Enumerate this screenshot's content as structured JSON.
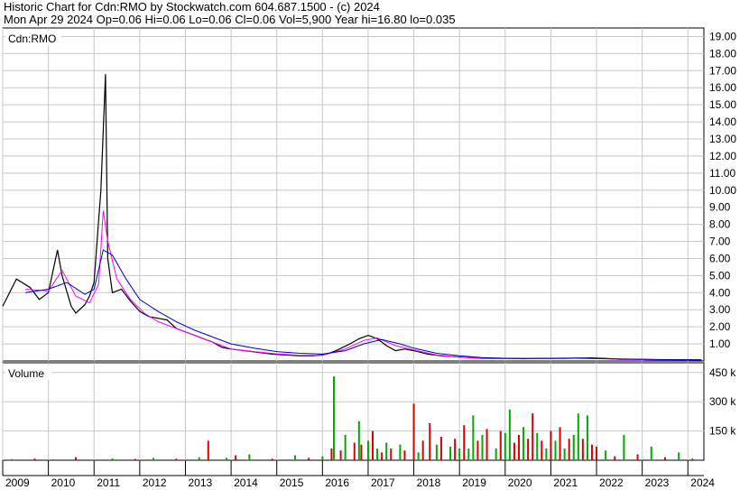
{
  "header": {
    "line1": "Historic Chart for Cdn:RMO by Stockwatch.com 604.687.1500 - (c) 2024",
    "line2": "Mon Apr 29 2024  Op=0.06  Hi=0.06  Lo=0.06  Cl=0.06  Vol=5,900  Year hi=16.80  lo=0.035"
  },
  "colors": {
    "price": "#000000",
    "ma_short": "#ff00ff",
    "ma_long": "#0000cc",
    "vol_up": "#00aa00",
    "vol_down": "#dd0000",
    "grid": "#c8c8c8"
  },
  "chart_data": [
    {
      "type": "line",
      "title": "Cdn:RMO",
      "ylim": [
        0,
        19.5
      ],
      "y_ticks": [
        "1.00",
        "2.00",
        "3.00",
        "4.00",
        "5.00",
        "6.00",
        "7.00",
        "8.00",
        "9.00",
        "10.00",
        "11.00",
        "12.00",
        "13.00",
        "14.00",
        "15.00",
        "16.00",
        "17.00",
        "18.00",
        "19.00"
      ],
      "x_ticks": [
        "2009",
        "2010",
        "2011",
        "2012",
        "2013",
        "2014",
        "2015",
        "2016",
        "2017",
        "2018",
        "2019",
        "2020",
        "2021",
        "2022",
        "2023",
        "2024"
      ],
      "series": [
        {
          "name": "",
          "x": [
            2009.0,
            2009.3,
            2009.6,
            2009.8,
            2010.0,
            2010.2,
            2010.3,
            2010.5,
            2010.6,
            2010.8,
            2010.9,
            2011.0,
            2011.15,
            2011.25,
            2011.3,
            2011.4,
            2011.6,
            2011.8,
            2012.0,
            2012.2,
            2012.4,
            2012.6,
            2012.8,
            2013.0,
            2013.2,
            2013.4,
            2013.6,
            2013.8,
            2014.0,
            2014.3,
            2014.6,
            2014.9,
            2015.2,
            2015.5,
            2015.8,
            2016.1,
            2016.3,
            2016.6,
            2016.8,
            2017.0,
            2017.2,
            2017.4,
            2017.6,
            2017.8,
            2018.0,
            2018.3,
            2018.6,
            2018.9,
            2019.2,
            2019.5,
            2019.8,
            2020.1,
            2020.4,
            2020.7,
            2021.0,
            2021.3,
            2021.6,
            2021.9,
            2022.2,
            2022.5,
            2022.8,
            2023.1,
            2023.4,
            2023.7,
            2024.0,
            2024.3
          ],
          "values": [
            3.2,
            4.8,
            4.3,
            3.6,
            4.0,
            6.5,
            5.0,
            3.2,
            2.8,
            3.3,
            3.8,
            4.6,
            10.0,
            16.8,
            6.0,
            4.0,
            4.2,
            3.5,
            2.9,
            2.6,
            2.5,
            2.4,
            1.9,
            1.7,
            1.5,
            1.3,
            1.1,
            0.8,
            0.7,
            0.6,
            0.5,
            0.4,
            0.35,
            0.3,
            0.3,
            0.4,
            0.6,
            1.0,
            1.3,
            1.5,
            1.3,
            0.9,
            0.6,
            0.7,
            0.6,
            0.4,
            0.3,
            0.25,
            0.2,
            0.15,
            0.15,
            0.15,
            0.13,
            0.15,
            0.15,
            0.15,
            0.17,
            0.18,
            0.15,
            0.1,
            0.1,
            0.08,
            0.07,
            0.07,
            0.06,
            0.06
          ]
        },
        {
          "name": "",
          "x": [
            2009.5,
            2010.0,
            2010.3,
            2010.6,
            2010.9,
            2011.1,
            2011.2,
            2011.3,
            2011.5,
            2011.8,
            2012.1,
            2012.4,
            2012.8,
            2013.2,
            2013.6,
            2014.0,
            2014.5,
            2015.0,
            2015.5,
            2016.0,
            2016.5,
            2016.9,
            2017.2,
            2017.6,
            2018.0,
            2018.5,
            2019.0,
            2019.5,
            2020.0,
            2020.5,
            2021.0,
            2021.5,
            2022.0,
            2022.5,
            2023.0,
            2023.5,
            2024.3
          ],
          "values": [
            4.2,
            4.1,
            5.3,
            3.8,
            3.4,
            4.5,
            8.8,
            7.0,
            4.8,
            3.6,
            2.8,
            2.3,
            1.9,
            1.5,
            1.1,
            0.7,
            0.55,
            0.42,
            0.33,
            0.33,
            0.7,
            1.2,
            1.35,
            0.9,
            0.65,
            0.35,
            0.22,
            0.16,
            0.14,
            0.14,
            0.15,
            0.16,
            0.14,
            0.1,
            0.08,
            0.07,
            0.06
          ]
        },
        {
          "name": "",
          "x": [
            2009.5,
            2010.0,
            2010.4,
            2010.8,
            2011.0,
            2011.2,
            2011.4,
            2011.7,
            2012.0,
            2012.4,
            2012.8,
            2013.2,
            2013.6,
            2014.0,
            2014.5,
            2015.0,
            2015.5,
            2016.0,
            2016.5,
            2016.9,
            2017.3,
            2017.7,
            2018.0,
            2018.5,
            2019.0,
            2019.5,
            2020.0,
            2020.5,
            2021.0,
            2021.5,
            2022.0,
            2022.5,
            2023.0,
            2023.5,
            2024.3
          ],
          "values": [
            4.0,
            4.2,
            4.6,
            3.9,
            4.2,
            6.5,
            6.2,
            4.8,
            3.6,
            2.9,
            2.3,
            1.8,
            1.4,
            1.0,
            0.75,
            0.55,
            0.45,
            0.4,
            0.6,
            1.0,
            1.25,
            1.0,
            0.75,
            0.45,
            0.3,
            0.2,
            0.16,
            0.15,
            0.16,
            0.17,
            0.15,
            0.12,
            0.1,
            0.08,
            0.07
          ]
        }
      ]
    },
    {
      "type": "bar",
      "title": "Volume",
      "ylim": [
        0,
        500000
      ],
      "y_ticks": [
        "150 k",
        "300 k",
        "450 k"
      ],
      "x": [
        2009.2,
        2009.7,
        2010.1,
        2010.6,
        2011.4,
        2011.9,
        2012.3,
        2012.8,
        2013.3,
        2013.5,
        2013.9,
        2014.1,
        2014.4,
        2014.9,
        2015.4,
        2015.7,
        2016.0,
        2016.2,
        2016.25,
        2016.4,
        2016.5,
        2016.7,
        2016.8,
        2016.85,
        2017.0,
        2017.1,
        2017.2,
        2017.3,
        2017.4,
        2017.5,
        2017.7,
        2017.8,
        2018.0,
        2018.1,
        2018.2,
        2018.35,
        2018.5,
        2018.6,
        2018.8,
        2018.9,
        2019.0,
        2019.1,
        2019.2,
        2019.3,
        2019.4,
        2019.5,
        2019.6,
        2019.8,
        2019.9,
        2020.0,
        2020.1,
        2020.2,
        2020.3,
        2020.4,
        2020.5,
        2020.6,
        2020.7,
        2020.8,
        2020.9,
        2021.0,
        2021.1,
        2021.2,
        2021.3,
        2021.4,
        2021.5,
        2021.6,
        2021.7,
        2021.8,
        2021.9,
        2022.0,
        2022.2,
        2022.4,
        2022.6,
        2022.9,
        2023.2,
        2023.5,
        2023.8,
        2024.1
      ],
      "values": [
        6000,
        8000,
        5000,
        15000,
        9000,
        7000,
        12000,
        8000,
        15000,
        100000,
        12000,
        25000,
        30000,
        8000,
        25000,
        12000,
        20000,
        60000,
        430000,
        50000,
        130000,
        90000,
        200000,
        80000,
        100000,
        150000,
        60000,
        40000,
        90000,
        60000,
        80000,
        50000,
        290000,
        40000,
        100000,
        190000,
        80000,
        120000,
        70000,
        110000,
        60000,
        180000,
        60000,
        230000,
        100000,
        130000,
        160000,
        60000,
        150000,
        140000,
        260000,
        90000,
        130000,
        170000,
        110000,
        240000,
        140000,
        100000,
        60000,
        150000,
        100000,
        170000,
        60000,
        110000,
        130000,
        240000,
        110000,
        230000,
        80000,
        70000,
        50000,
        20000,
        130000,
        30000,
        70000,
        15000,
        40000,
        8000
      ],
      "up": [
        true,
        false,
        true,
        false,
        true,
        false,
        true,
        false,
        true,
        false,
        true,
        false,
        true,
        false,
        true,
        false,
        true,
        false,
        true,
        false,
        true,
        false,
        true,
        false,
        true,
        false,
        true,
        false,
        true,
        false,
        true,
        false,
        false,
        true,
        false,
        false,
        true,
        false,
        true,
        false,
        true,
        false,
        true,
        true,
        false,
        true,
        false,
        true,
        false,
        true,
        true,
        false,
        false,
        true,
        false,
        false,
        true,
        false,
        true,
        false,
        true,
        false,
        true,
        false,
        true,
        true,
        false,
        true,
        false,
        false,
        true,
        false,
        true,
        false,
        true,
        false,
        true,
        false
      ]
    }
  ]
}
